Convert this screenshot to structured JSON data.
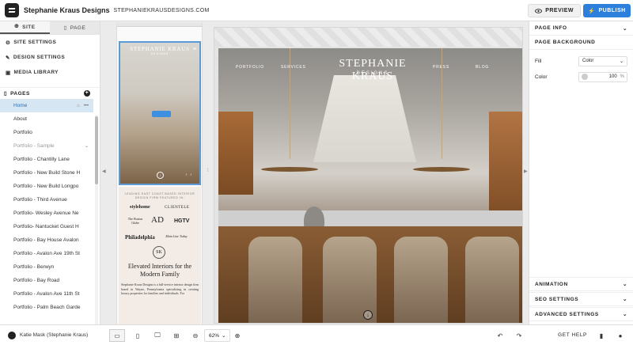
{
  "header": {
    "site_name": "Stephanie Kraus Designs",
    "site_url": "STEPHANIEKRAUSDESIGNS.COM",
    "preview_label": "PREVIEW",
    "publish_label": "PUBLISH"
  },
  "sidebar": {
    "tabs": [
      {
        "label": "SITE"
      },
      {
        "label": "PAGE"
      }
    ],
    "menu": [
      {
        "label": "SITE SETTINGS",
        "icon": "gear-icon"
      },
      {
        "label": "DESIGN SETTINGS",
        "icon": "pen-icon"
      },
      {
        "label": "MEDIA LIBRARY",
        "icon": "image-icon"
      }
    ],
    "pages_label": "PAGES",
    "pages": [
      "Home",
      "About",
      "Portfolio",
      "Portfolio - Sample",
      "Portfolio - Chantilly Lane",
      "Portfolio - New Build Stone H",
      "Portfolio - New Build Longpo",
      "Portfolio - Third Avenue",
      "Portfolio- Wesley Avenue Ne",
      "Portfolio- Nantucket Guest H",
      "Portfolio - Bay House Avalon",
      "Portfolio - Avalon Ave 19th St",
      "Portfolio - Berwyn",
      "Portfolio - Bay Road",
      "Portfolio - Avalon Ave 11th St",
      "Portfolio - Palm Beach Garde"
    ]
  },
  "mobile_preview": {
    "title": "STEPHANIE KRAUS",
    "subtitle": "DESIGNS",
    "press_text": "LEADING EAST COAST BASED INTERIOR DESIGN FIRM FEATURED IN:",
    "press_logos": [
      "stylehome",
      "CLIENTELE",
      "The Boston Globe",
      "AD",
      "HGTV",
      "Philadelphia",
      "Main Line Today"
    ],
    "emblem": "SK",
    "heading": "Elevated Interiors for the Modern Family",
    "bio": "Stephanie Kraus Designs is a full-service interior design firm based in Wayne, Pennsylvania specializing in creating luxury properties for families and individuals. For"
  },
  "desktop_preview": {
    "nav_left": [
      "PORTFOLIO",
      "SERVICES"
    ],
    "nav_right": [
      "PRESS",
      "BLOG"
    ],
    "title": "STEPHANIE KRAUS",
    "subtitle": "DESIGNS"
  },
  "right_panel": {
    "page_info": "PAGE INFO",
    "page_background": "PAGE BACKGROUND",
    "fill_label": "Fill",
    "fill_value": "Color",
    "color_label": "Color",
    "opacity": "100",
    "opacity_unit": "%",
    "animation": "ANIMATION",
    "seo": "SEO SETTINGS",
    "advanced": "ADVANCED SETTINGS"
  },
  "footer": {
    "user": "Katie Mask (Stephanie Kraus)",
    "zoom": "62%",
    "get_help": "GET HELP"
  }
}
